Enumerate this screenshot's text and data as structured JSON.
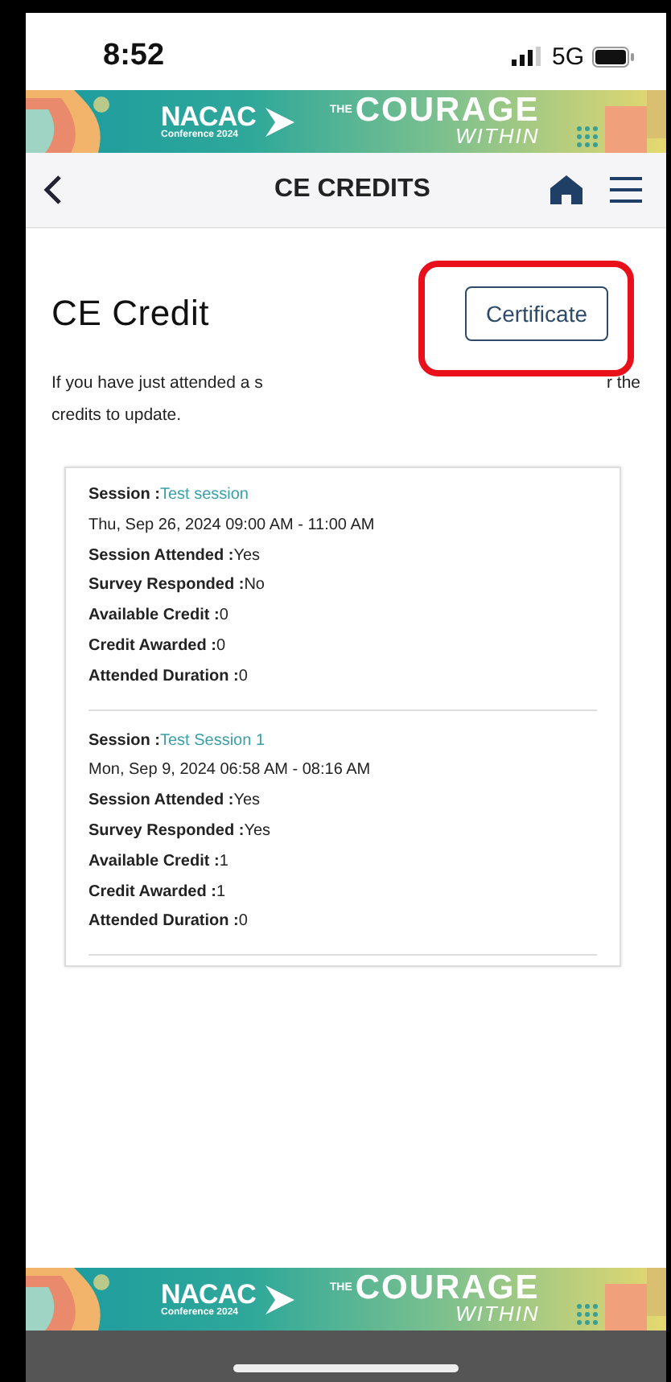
{
  "status_bar": {
    "time": "8:52",
    "network": "5G"
  },
  "banner_top": {
    "brand": "NACAC",
    "subtitle": "Conference 2024",
    "prefix": "THE",
    "headline": "COURAGE",
    "tagline": "WITHIN"
  },
  "nav": {
    "title": "CE CREDITS"
  },
  "page": {
    "heading": "CE Credit",
    "certificate_button": {
      "label": "Certificate",
      "highlighted": true
    },
    "intro_lines": [
      {
        "start": "If you have just attended a s",
        "end": "r the"
      },
      {
        "start": "credits to update."
      }
    ]
  },
  "sessions": [
    {
      "session_label": "Session :",
      "session_name": "Test session",
      "datetime": "Thu, Sep 26, 2024 09:00 AM - 11:00 AM",
      "fields": [
        {
          "label": "Session Attended :",
          "value": "Yes"
        },
        {
          "label": "Survey Responded :",
          "value": "No"
        },
        {
          "label": "Available Credit :",
          "value": "0"
        },
        {
          "label": "Credit Awarded :",
          "value": "0"
        },
        {
          "label": "Attended Duration :",
          "value": "0"
        }
      ]
    },
    {
      "session_label": "Session :",
      "session_name": "Test Session 1",
      "datetime": "Mon, Sep 9, 2024 06:58 AM - 08:16 AM",
      "fields": [
        {
          "label": "Session Attended :",
          "value": "Yes"
        },
        {
          "label": "Survey Responded :",
          "value": "Yes"
        },
        {
          "label": "Available Credit :",
          "value": "1"
        },
        {
          "label": "Credit Awarded :",
          "value": "1"
        },
        {
          "label": "Attended Duration :",
          "value": "0"
        }
      ]
    }
  ],
  "banner_bottom": {
    "brand": "NACAC",
    "subtitle": "Conference 2024",
    "prefix": "THE",
    "headline": "COURAGE",
    "tagline": "WITHIN"
  }
}
